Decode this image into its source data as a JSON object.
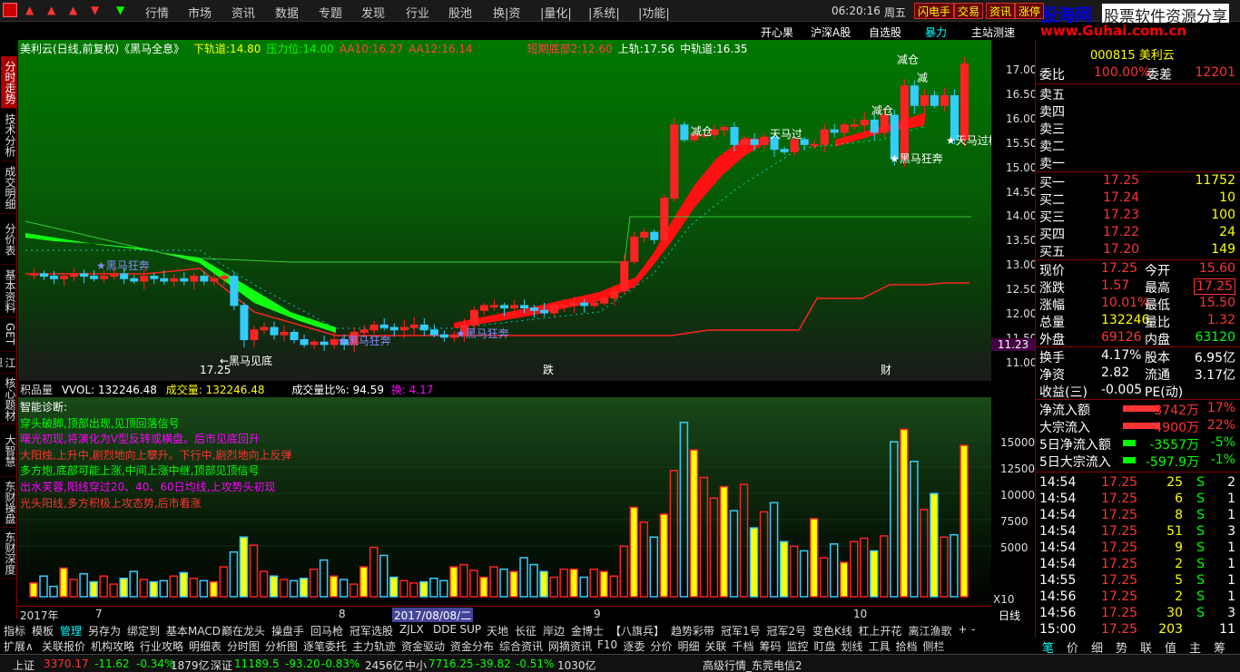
{
  "menu": {
    "items": [
      "行情",
      "市场",
      "资讯",
      "数据",
      "专题",
      "发现",
      "行业",
      "股池",
      "换|资",
      "|量化|",
      "|系统|",
      "|功能|"
    ],
    "clock": "06:20:16",
    "weekday": "周五",
    "toptabs": [
      "闪电手",
      "交易",
      "资讯",
      "涨停"
    ]
  },
  "brand": {
    "name": "股海网",
    "slogan": "股票软件资源分享",
    "url": "www.Guhai.com.cn"
  },
  "subbar": {
    "items": [
      "开心果",
      "沪深A股",
      "自选股",
      "暴力",
      "主站测速"
    ]
  },
  "left_tabs": [
    "分时走势",
    "技术分析",
    "成交明细",
    "分价表",
    "基本资料",
    "GET",
    "江恩",
    "核心题材",
    "大智慧",
    "东财操盘",
    "东财深度"
  ],
  "chart": {
    "stock_title": "美利云(日线,前复权)《黑马全息》",
    "indicators": [
      {
        "label": "下轨道:14.80",
        "color": "#ff0"
      },
      {
        "label": "压力位:14.00",
        "color": "#0f0"
      },
      {
        "label": "AA10:16.27",
        "color": "#f44"
      },
      {
        "label": "AA12:16.14",
        "color": "#f44"
      },
      {
        "label": "短期底部2:12.60",
        "color": "#f44"
      },
      {
        "label": "上轨:17.56",
        "color": "#fff"
      },
      {
        "label": "中轨道:16.35",
        "color": "#fff"
      }
    ],
    "price_ticks": [
      "17.00",
      "16.50",
      "16.00",
      "15.50",
      "15.00",
      "14.50",
      "14.00",
      "13.50",
      "13.00",
      "12.50",
      "12.00",
      "11.50",
      "11.00"
    ],
    "current_price_tag": "11.23",
    "annotations": [
      "黑马狂奔",
      "黑马狂奔",
      "黑马狂奔",
      "黑马狂奔",
      "天马过桥",
      "天马过",
      "减仓",
      "减仓",
      "减",
      "减仓",
      "17.25",
      "跌",
      "财",
      "榜",
      "←黑马见底"
    ],
    "vol_info": {
      "name": "积品量",
      "vvol": "VVOL: 132246.48",
      "vol": "成交量: 132246.48",
      "ratio": "成交量比%: 94.59",
      "huan": "换: 4.17"
    },
    "diagnosis": [
      {
        "text": "智能诊断:",
        "color": "#fff"
      },
      {
        "text": "穿头破脚,顶部出现,见顶回落信号",
        "color": "#0f0"
      },
      {
        "text": "曙光初现,将演化为V型反转或横盘。后市见底回升",
        "color": "#f0f"
      },
      {
        "text": "大阳烛,上升中,剧烈地向上攀升。下行中,剧烈地向上反弹",
        "color": "#f33"
      },
      {
        "text": "多方炮,底部可能上涨,中间上涨中继,顶部见顶信号",
        "color": "#0f0"
      },
      {
        "text": "出水芙蓉,阳线穿过20、40、60日均线,上攻势头初现",
        "color": "#f0f"
      },
      {
        "text": "光头阳线,多方积极上攻态势,后市看涨",
        "color": "#f33"
      }
    ],
    "vol_ticks": [
      "15000",
      "12500",
      "10000",
      "7500",
      "5000",
      "X10"
    ],
    "date_labels": [
      "2017年",
      "7",
      "8",
      "2017/08/08/二",
      "9",
      "10"
    ],
    "period": "日线"
  },
  "toolrow1": [
    "指标",
    "模板",
    "管理",
    "另存为",
    "绑定到",
    "基本MACD",
    "巅在龙头",
    "操盘手",
    "回马枪",
    "冠军选股",
    "ZJLX",
    "DDE",
    "SUP",
    "天地",
    "长征",
    "岸边",
    "金博士",
    "【八旗兵】",
    "趋势彩带",
    "冠军1号",
    "冠军2号",
    "变色K线",
    "杠上开花",
    "离江渔歌",
    "+",
    "-"
  ],
  "toolrow2": [
    "扩展∧",
    "关联报价",
    "机构攻略",
    "行业攻略",
    "明细表",
    "分时图",
    "分析图",
    "逐笔委托",
    "主力轨迹",
    "资金驱动",
    "资金分布",
    "综合资讯",
    "网摘资讯",
    "F10",
    "逐委",
    "分价",
    "明细",
    "关联",
    "千档",
    "筹码",
    "监控",
    "盯盘",
    "划线",
    "工具",
    "拾档",
    "侧栏"
  ],
  "statusbar": [
    {
      "text": "上证",
      "color": "#ddd"
    },
    {
      "text": "3370.17",
      "color": "#f33"
    },
    {
      "text": "-11.62",
      "color": "#0f0"
    },
    {
      "text": "-0.34%",
      "color": "#0f0"
    },
    {
      "text": "1879亿",
      "color": "#ddd"
    },
    {
      "text": "深证",
      "color": "#ddd"
    },
    {
      "text": "11189.5",
      "color": "#0f0"
    },
    {
      "text": "-93.20",
      "color": "#0f0"
    },
    {
      "text": "-0.83%",
      "color": "#0f0"
    },
    {
      "text": "2456亿",
      "color": "#ddd"
    },
    {
      "text": "中小",
      "color": "#ddd"
    },
    {
      "text": "7716.25",
      "color": "#0f0"
    },
    {
      "text": "-39.82",
      "color": "#0f0"
    },
    {
      "text": "-0.51%",
      "color": "#0f0"
    },
    {
      "text": "1030亿",
      "color": "#ddd"
    },
    {
      "text": "高级行情_东莞电信2",
      "color": "#ddd"
    }
  ],
  "quote": {
    "code": "000815 美利云",
    "weibi_label": "委比",
    "weibi": "100.00%",
    "weicha_label": "委差",
    "weicha": "12201",
    "asks": [
      {
        "label": "卖五"
      },
      {
        "label": "卖四"
      },
      {
        "label": "卖三"
      },
      {
        "label": "卖二"
      },
      {
        "label": "卖一"
      }
    ],
    "bids": [
      {
        "label": "买一",
        "price": "17.25",
        "vol": "11752"
      },
      {
        "label": "买二",
        "price": "17.24",
        "vol": "10"
      },
      {
        "label": "买三",
        "price": "17.23",
        "vol": "100"
      },
      {
        "label": "买四",
        "price": "17.22",
        "vol": "24"
      },
      {
        "label": "买五",
        "price": "17.20",
        "vol": "149"
      }
    ],
    "stats": [
      {
        "l1": "现价",
        "v1": "17.25",
        "l2": "今开",
        "v2": "15.60"
      },
      {
        "l1": "涨跌",
        "v1": "1.57",
        "l2": "最高",
        "v2": "17.25"
      },
      {
        "l1": "涨幅",
        "v1": "10.01%",
        "l2": "最低",
        "v2": "15.50"
      },
      {
        "l1": "总量",
        "v1": "132246",
        "l2": "量比",
        "v2": "1.32"
      },
      {
        "l1": "外盘",
        "v1": "69126",
        "l2": "内盘",
        "v2": "63120"
      }
    ],
    "fundamentals": [
      {
        "l1": "换手",
        "v1": "4.17%",
        "l2": "股本",
        "v2": "6.95亿"
      },
      {
        "l1": "净资",
        "v1": "2.82",
        "l2": "流通",
        "v2": "3.17亿"
      },
      {
        "l1": "收益(三)",
        "v1": "-0.005",
        "l2": "PE(动)",
        "v2": ""
      }
    ],
    "flows": [
      {
        "label": "净流入额",
        "value": "3742万",
        "pct": "17%",
        "color": "#f33"
      },
      {
        "label": "大宗流入",
        "value": "4900万",
        "pct": "22%",
        "color": "#f33"
      },
      {
        "label": "5日净流入额",
        "value": "-3557万",
        "pct": "-5%",
        "color": "#0f0"
      },
      {
        "label": "5日大宗流入",
        "value": "-597.9万",
        "pct": "-1%",
        "color": "#0f0"
      }
    ],
    "ticks": [
      {
        "t": "14:54",
        "p": "17.25",
        "v": "25",
        "s": "S",
        "n": "2"
      },
      {
        "t": "14:54",
        "p": "17.25",
        "v": "6",
        "s": "S",
        "n": "1"
      },
      {
        "t": "14:54",
        "p": "17.25",
        "v": "8",
        "s": "S",
        "n": "1"
      },
      {
        "t": "14:54",
        "p": "17.25",
        "v": "51",
        "s": "S",
        "n": "3"
      },
      {
        "t": "14:54",
        "p": "17.25",
        "v": "9",
        "s": "S",
        "n": "1"
      },
      {
        "t": "14:54",
        "p": "17.25",
        "v": "2",
        "s": "S",
        "n": "1"
      },
      {
        "t": "14:55",
        "p": "17.25",
        "v": "5",
        "s": "S",
        "n": "1"
      },
      {
        "t": "14:56",
        "p": "17.25",
        "v": "2",
        "s": "S",
        "n": "1"
      },
      {
        "t": "14:56",
        "p": "17.25",
        "v": "30",
        "s": "S",
        "n": "3"
      },
      {
        "t": "15:00",
        "p": "17.25",
        "v": "203",
        "s": "",
        "n": "11"
      }
    ],
    "bottom_tabs": [
      "笔",
      "价",
      "细",
      "势",
      "联",
      "值",
      "主",
      "筹"
    ]
  }
}
